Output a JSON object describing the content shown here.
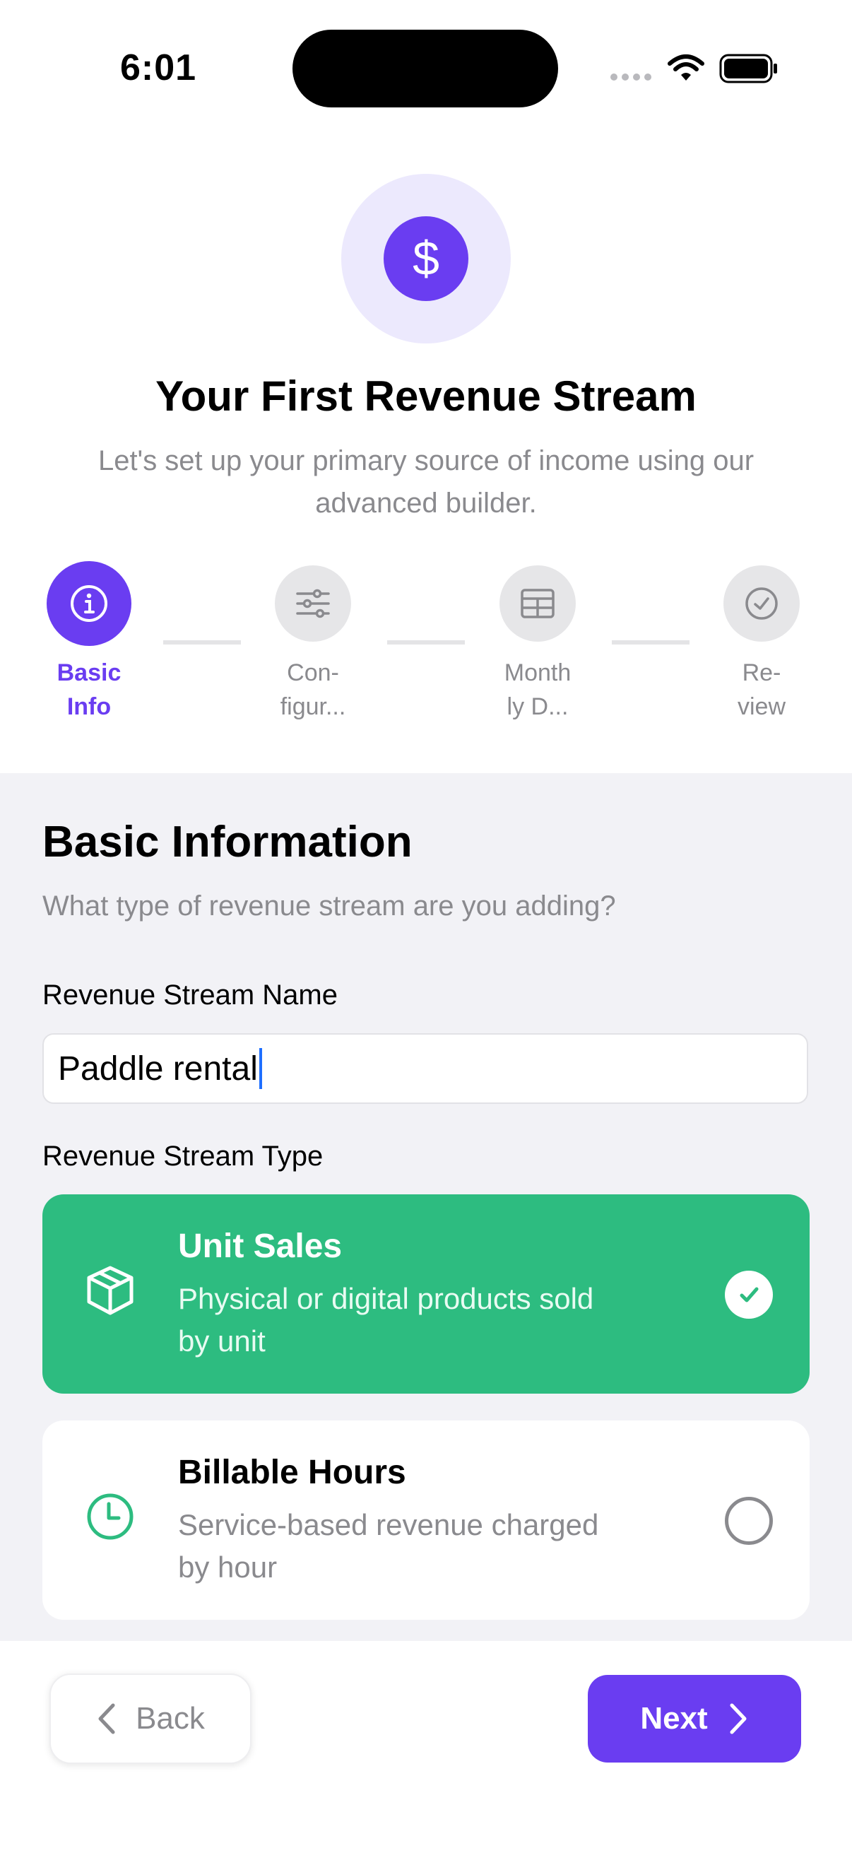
{
  "status_bar": {
    "time": "6:01"
  },
  "hero": {
    "icon": "dollar-icon",
    "symbol": "$",
    "title": "Your First Revenue Stream",
    "subtitle": "Let's set up your primary source of income using our advanced builder."
  },
  "stepper": {
    "steps": [
      {
        "label": "Basic\nInfo",
        "icon": "info-icon",
        "active": true
      },
      {
        "label": "Con-\nfigur...",
        "icon": "sliders-icon",
        "active": false
      },
      {
        "label": "Month\nly D...",
        "icon": "table-icon",
        "active": false
      },
      {
        "label": "Re-\nview",
        "icon": "check-circle-icon",
        "active": false
      }
    ]
  },
  "form": {
    "section_title": "Basic Information",
    "section_subtitle": "What type of revenue stream are you adding?",
    "name_label": "Revenue Stream Name",
    "name_value": "Paddle rental",
    "type_label": "Revenue Stream Type",
    "options": [
      {
        "title": "Unit Sales",
        "description": "Physical or digital products sold by unit",
        "icon": "box-icon",
        "selected": true
      },
      {
        "title": "Billable Hours",
        "description": "Service-based revenue charged by hour",
        "icon": "clock-icon",
        "selected": false
      }
    ]
  },
  "footer": {
    "back_label": "Back",
    "next_label": "Next"
  },
  "colors": {
    "accent": "#6a3df1",
    "selected_option": "#2dbc80",
    "muted_text": "#8a8a8e",
    "section_bg": "#f2f2f6"
  }
}
